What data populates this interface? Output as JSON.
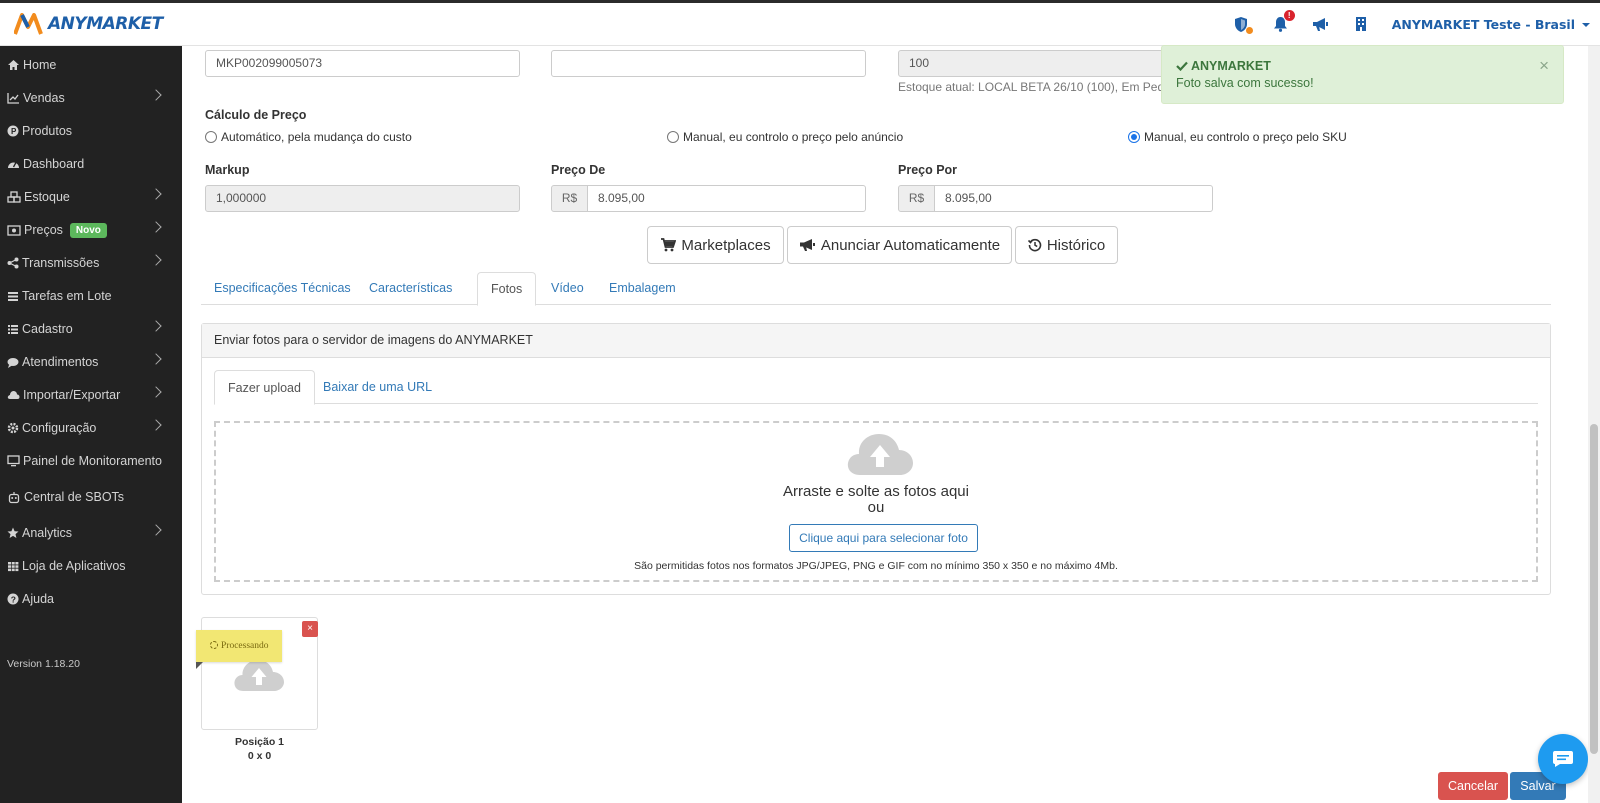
{
  "app": {
    "logo_text": "ANYMARKET",
    "user_name": "ANYMARKET Teste - Brasil",
    "notification_count": "!"
  },
  "sidebar": {
    "items": [
      {
        "label": "Home",
        "icon": "home-icon",
        "chevron": false
      },
      {
        "label": "Vendas",
        "icon": "chart-line-icon",
        "chevron": true
      },
      {
        "label": "Produtos",
        "icon": "product-hunt-icon",
        "chevron": false
      },
      {
        "label": "Dashboard",
        "icon": "dashboard-icon",
        "chevron": false
      },
      {
        "label": "Estoque",
        "icon": "cubes-icon",
        "chevron": true
      },
      {
        "label": "Preços",
        "icon": "money-icon",
        "chevron": true,
        "badge": "Novo"
      },
      {
        "label": "Transmissões",
        "icon": "share-icon",
        "chevron": true
      },
      {
        "label": "Tarefas em Lote",
        "icon": "list-icon",
        "chevron": false
      },
      {
        "label": "Cadastro",
        "icon": "list-ul-icon",
        "chevron": true
      },
      {
        "label": "Atendimentos",
        "icon": "comment-icon",
        "chevron": true
      },
      {
        "label": "Importar/Exportar",
        "icon": "cloud-icon",
        "chevron": true
      },
      {
        "label": "Configuração",
        "icon": "gear-icon",
        "chevron": true
      },
      {
        "label": "Painel de Monitoramento",
        "icon": "desktop-icon",
        "chevron": false
      },
      {
        "label": "Central de SBOTs",
        "icon": "robot-icon",
        "chevron": false
      },
      {
        "label": "Analytics",
        "icon": "star-icon",
        "chevron": true
      },
      {
        "label": "Loja de Aplicativos",
        "icon": "th-icon",
        "chevron": false
      },
      {
        "label": "Ajuda",
        "icon": "question-icon",
        "chevron": false
      }
    ],
    "version": "Version 1.18.20"
  },
  "form": {
    "sku_value": "MKP002099005073",
    "field2_value": "",
    "stock_value": "100",
    "stock_note": "Estoque atual: LOCAL BETA 26/10 (100), Em Ped",
    "price_calc_label": "Cálculo de Preço",
    "radio_options": [
      {
        "label": "Automático, pela mudança do custo",
        "checked": false
      },
      {
        "label": "Manual, eu controlo o preço pelo anúncio",
        "checked": false
      },
      {
        "label": "Manual, eu controlo o preço pelo SKU",
        "checked": true
      }
    ],
    "markup_label": "Markup",
    "markup_value": "1,000000",
    "preco_de_label": "Preço De",
    "preco_de_currency": "R$",
    "preco_de_value": "8.095,00",
    "preco_por_label": "Preço Por",
    "preco_por_currency": "R$",
    "preco_por_value": "8.095,00"
  },
  "actions": {
    "marketplaces": "Marketplaces",
    "anunciar": "Anunciar Automaticamente",
    "historico": "Histórico"
  },
  "tabs": [
    {
      "label": "Especificações Técnicas",
      "active": false
    },
    {
      "label": "Características",
      "active": false
    },
    {
      "label": "Fotos",
      "active": true
    },
    {
      "label": "Vídeo",
      "active": false
    },
    {
      "label": "Embalagem",
      "active": false
    }
  ],
  "photos": {
    "panel_title": "Enviar fotos para o servidor de imagens do ANYMARKET",
    "subtabs": [
      {
        "label": "Fazer upload",
        "active": true
      },
      {
        "label": "Baixar de uma URL",
        "active": false
      }
    ],
    "drop_text": "Arraste e solte as fotos aqui",
    "drop_or": "ou",
    "select_button": "Clique aqui para selecionar foto",
    "note": "São permitidas fotos nos formatos JPG/JPEG, PNG e GIF com no mínimo 350 x 350 e no máximo 4Mb.",
    "thumb_status": "Processando",
    "thumb_remove": "×",
    "thumb_position": "Posição 1",
    "thumb_size": "0 x 0"
  },
  "footer": {
    "cancel": "Cancelar",
    "save": "Salvar"
  },
  "alert": {
    "title": "ANYMARKET",
    "message": "Foto salva com sucesso!",
    "close": "×"
  },
  "colors": {
    "sidebar_bg": "#222222",
    "link": "#337ab7",
    "success_bg": "#dff0d8",
    "danger": "#d9534f",
    "primary": "#337ab7",
    "brand_orange": "#f28c1e",
    "brand_blue": "#1e5fa8"
  }
}
